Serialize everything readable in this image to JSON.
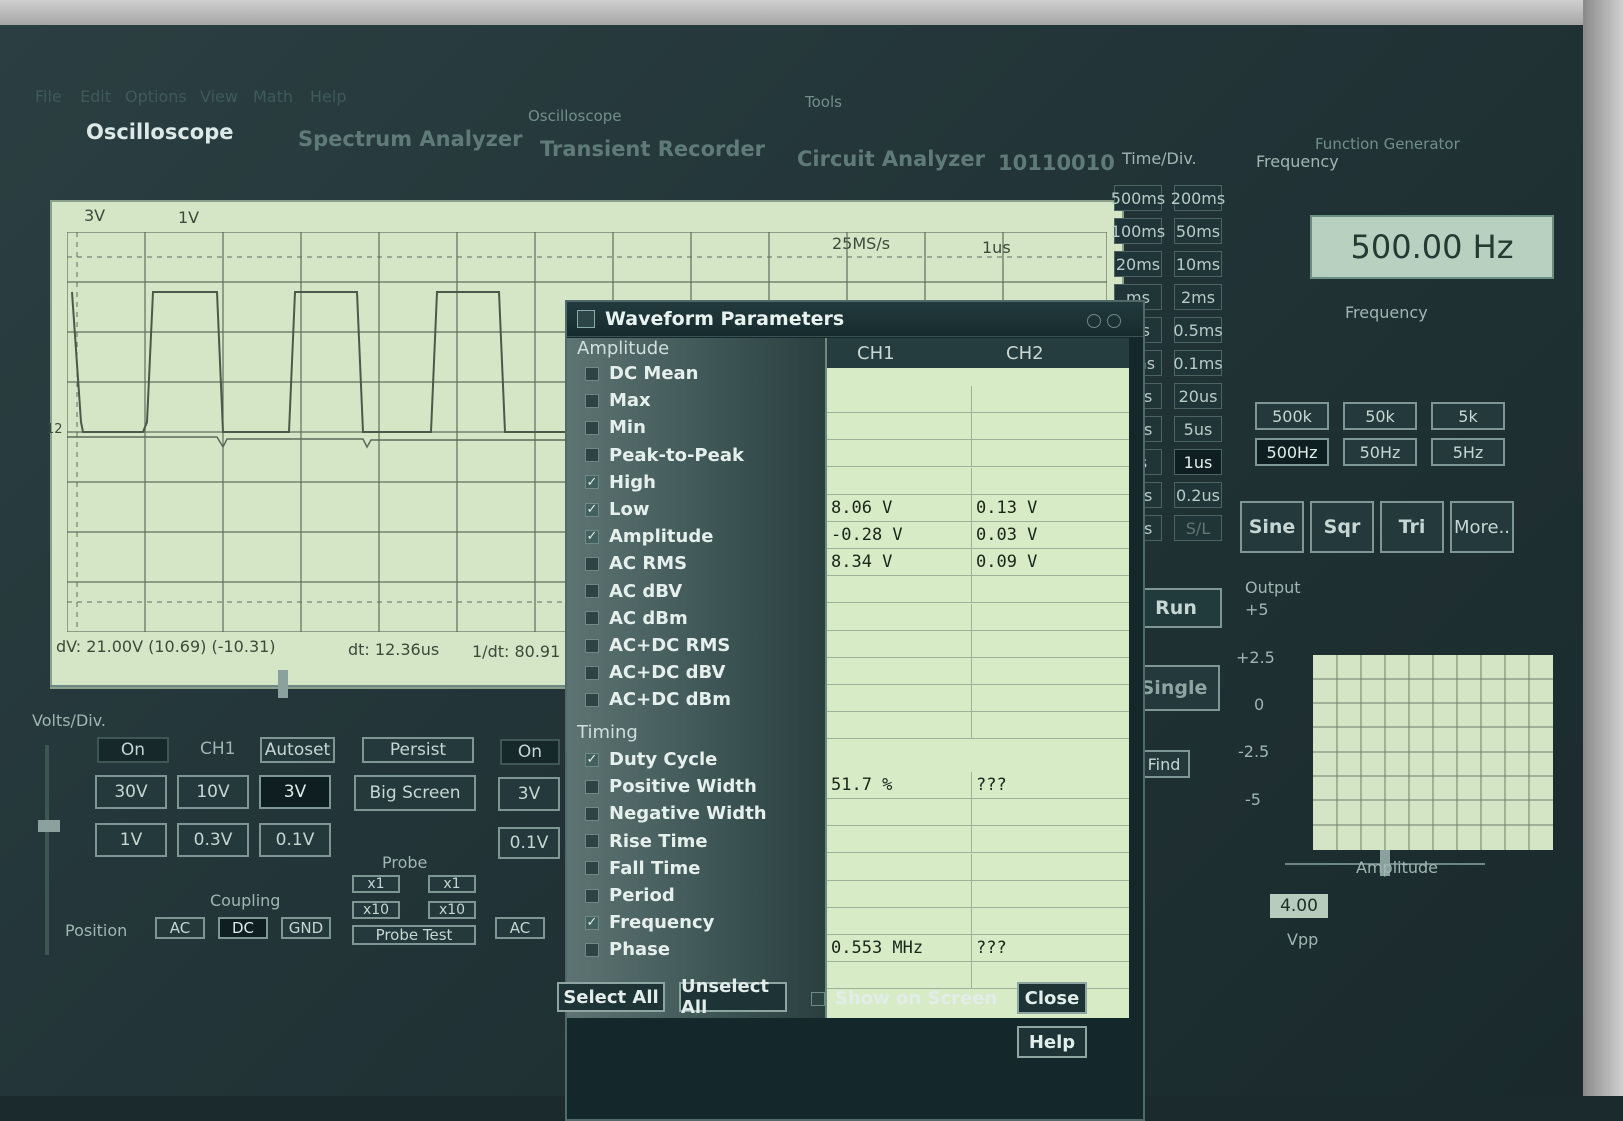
{
  "menu": [
    "File",
    "Edit",
    "Options",
    "View",
    "Math",
    "Help"
  ],
  "group_labels": {
    "oscilloscope": "Oscilloscope",
    "tools": "Tools",
    "function_generator": "Function Generator"
  },
  "tabs": [
    "Oscilloscope",
    "Spectrum Analyzer",
    "Transient Recorder",
    "Circuit Analyzer",
    "10110010"
  ],
  "scope": {
    "ch1_scale": "3V",
    "ch2_scale": "1V",
    "sample_rate": "25MS/s",
    "timebase": "1us",
    "trigger_level_marker": "12",
    "dv": "dV: 21.00V (10.69) (-10.31)",
    "dt": "dt: 12.36us",
    "inv_dt": "1/dt: 80.91"
  },
  "timediv": {
    "label": "Time/Div.",
    "buttons": [
      "500ms",
      "200ms",
      "100ms",
      "50ms",
      "20ms",
      "10ms",
      "ms",
      "2ms",
      "ms",
      "0.5ms",
      "2ms",
      "0.1ms",
      "0us",
      "20us",
      "0us",
      "5us",
      "us",
      "1us",
      "5us",
      "0.2us",
      "1us",
      "S/L"
    ],
    "run": "Run",
    "single": "Single",
    "find": "Find"
  },
  "volts_panel": {
    "label": "Volts/Div.",
    "on": "On",
    "ch_label": "CH1",
    "autoset": "Autoset",
    "persist": "Persist",
    "big_screen": "Big Screen",
    "scales": [
      "30V",
      "10V",
      "3V",
      "1V",
      "0.3V",
      "0.1V"
    ],
    "ch2_on": "On",
    "ch2_scale": "3V",
    "ch2_fine": "0.1V",
    "probe_label": "Probe",
    "probe_x1": "x1",
    "probe_x10": "x10",
    "probe_x1_b": "x1",
    "probe_x10_b": "x10",
    "probe_test": "Probe Test",
    "coupling_label": "Coupling",
    "position_label": "Position",
    "coupling": [
      "AC",
      "DC",
      "GND"
    ],
    "ch2_coupling": "AC"
  },
  "fgen": {
    "frequency_label": "Frequency",
    "frequency_display": "500.00 Hz",
    "frequency_slider_label": "Frequency",
    "range_buttons": [
      "500k",
      "50k",
      "5k",
      "500Hz",
      "50Hz",
      "5Hz"
    ],
    "waveforms": [
      "Sine",
      "Sqr",
      "Tri",
      "More.."
    ],
    "output_label": "Output",
    "output_ticks": [
      "+5",
      "+2.5",
      "0",
      "-2.5",
      "-5"
    ],
    "amplitude_label": "Amplitude",
    "amplitude_value": "4.00",
    "amplitude_unit": "Vpp"
  },
  "dialog": {
    "title": "Waveform Parameters",
    "section_amplitude": "Amplitude",
    "section_timing": "Timing",
    "col1": "CH1",
    "col2": "CH2",
    "amplitude_params": [
      {
        "name": "DC  Mean",
        "checked": false,
        "ch1": "",
        "ch2": ""
      },
      {
        "name": "Max",
        "checked": false,
        "ch1": "",
        "ch2": ""
      },
      {
        "name": "Min",
        "checked": false,
        "ch1": "",
        "ch2": ""
      },
      {
        "name": "Peak-to-Peak",
        "checked": false,
        "ch1": "",
        "ch2": ""
      },
      {
        "name": "High",
        "checked": true,
        "ch1": "8.06 V",
        "ch2": "0.13 V"
      },
      {
        "name": "Low",
        "checked": true,
        "ch1": "-0.28 V",
        "ch2": "0.03 V"
      },
      {
        "name": "Amplitude",
        "checked": true,
        "ch1": "8.34 V",
        "ch2": "0.09 V"
      },
      {
        "name": "AC RMS",
        "checked": false,
        "ch1": "",
        "ch2": ""
      },
      {
        "name": "AC dBV",
        "checked": false,
        "ch1": "",
        "ch2": ""
      },
      {
        "name": "AC dBm",
        "checked": false,
        "ch1": "",
        "ch2": ""
      },
      {
        "name": "AC+DC RMS",
        "checked": false,
        "ch1": "",
        "ch2": ""
      },
      {
        "name": "AC+DC dBV",
        "checked": false,
        "ch1": "",
        "ch2": ""
      },
      {
        "name": "AC+DC dBm",
        "checked": false,
        "ch1": "",
        "ch2": ""
      }
    ],
    "timing_params": [
      {
        "name": "Duty Cycle",
        "checked": true,
        "ch1": "51.7 %",
        "ch2": "???"
      },
      {
        "name": "Positive Width",
        "checked": false,
        "ch1": "",
        "ch2": ""
      },
      {
        "name": "Negative Width",
        "checked": false,
        "ch1": "",
        "ch2": ""
      },
      {
        "name": "Rise Time",
        "checked": false,
        "ch1": "",
        "ch2": ""
      },
      {
        "name": "Fall Time",
        "checked": false,
        "ch1": "",
        "ch2": ""
      },
      {
        "name": "Period",
        "checked": false,
        "ch1": "",
        "ch2": ""
      },
      {
        "name": "Frequency",
        "checked": true,
        "ch1": "0.553 MHz",
        "ch2": "???"
      },
      {
        "name": "Phase",
        "checked": false,
        "ch1": "",
        "ch2": ""
      }
    ],
    "select_all": "Select All",
    "unselect_all": "Unselect All",
    "show_on_screen": "Show on Screen",
    "close": "Close",
    "help": "Help"
  },
  "colors": {
    "scope_bg": "#d5e6c6",
    "trace": "#4a5a4a",
    "dialog_bg": "#14282c"
  }
}
